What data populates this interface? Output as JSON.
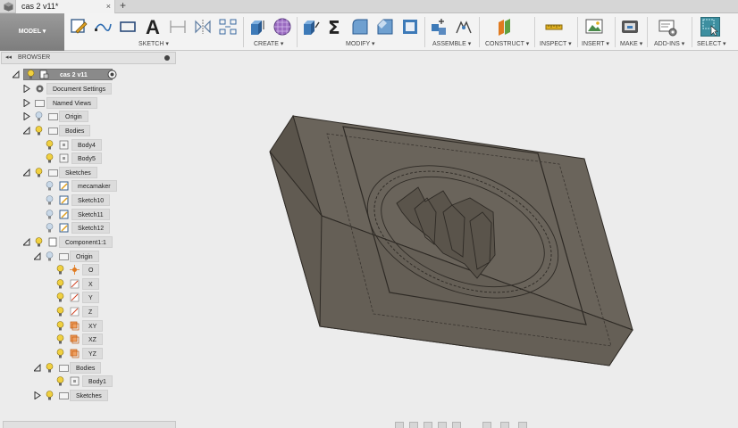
{
  "document_tab": {
    "title": "cas 2 v11*",
    "close": "×",
    "new_tab": "+"
  },
  "workspace": {
    "label": "MODEL",
    "arrow": "▾"
  },
  "toolbar": {
    "groups": [
      {
        "id": "sketch",
        "label": "SKETCH"
      },
      {
        "id": "create",
        "label": "CREATE"
      },
      {
        "id": "modify",
        "label": "MODIFY"
      },
      {
        "id": "assemble",
        "label": "ASSEMBLE"
      },
      {
        "id": "construct",
        "label": "CONSTRUCT"
      },
      {
        "id": "inspect",
        "label": "INSPECT"
      },
      {
        "id": "insert",
        "label": "INSERT"
      },
      {
        "id": "make",
        "label": "MAKE"
      },
      {
        "id": "addins",
        "label": "ADD-INS"
      },
      {
        "id": "select",
        "label": "SELECT"
      }
    ]
  },
  "browser": {
    "title": "BROWSER",
    "collapse": "◂◂",
    "root": {
      "label": "cas 2 v11"
    },
    "items": [
      {
        "label": "Document Settings"
      },
      {
        "label": "Named Views"
      },
      {
        "label": "Origin"
      },
      {
        "label": "Bodies"
      },
      {
        "label": "Body4"
      },
      {
        "label": "Body5"
      },
      {
        "label": "Sketches"
      },
      {
        "label": "mecamaker"
      },
      {
        "label": "Sketch10"
      },
      {
        "label": "Sketch11"
      },
      {
        "label": "Sketch12"
      },
      {
        "label": "Component1:1"
      },
      {
        "label": "Origin"
      },
      {
        "label": "O"
      },
      {
        "label": "X"
      },
      {
        "label": "Y"
      },
      {
        "label": "Z"
      },
      {
        "label": "XY"
      },
      {
        "label": "XZ"
      },
      {
        "label": "YZ"
      },
      {
        "label": "Bodies"
      },
      {
        "label": "Body1"
      },
      {
        "label": "Sketches"
      }
    ]
  },
  "colors": {
    "model_face": "#5f5950",
    "model_top": "#6a645b",
    "model_edge": "#2e2a25",
    "select_accent": "#3d8fa0"
  }
}
